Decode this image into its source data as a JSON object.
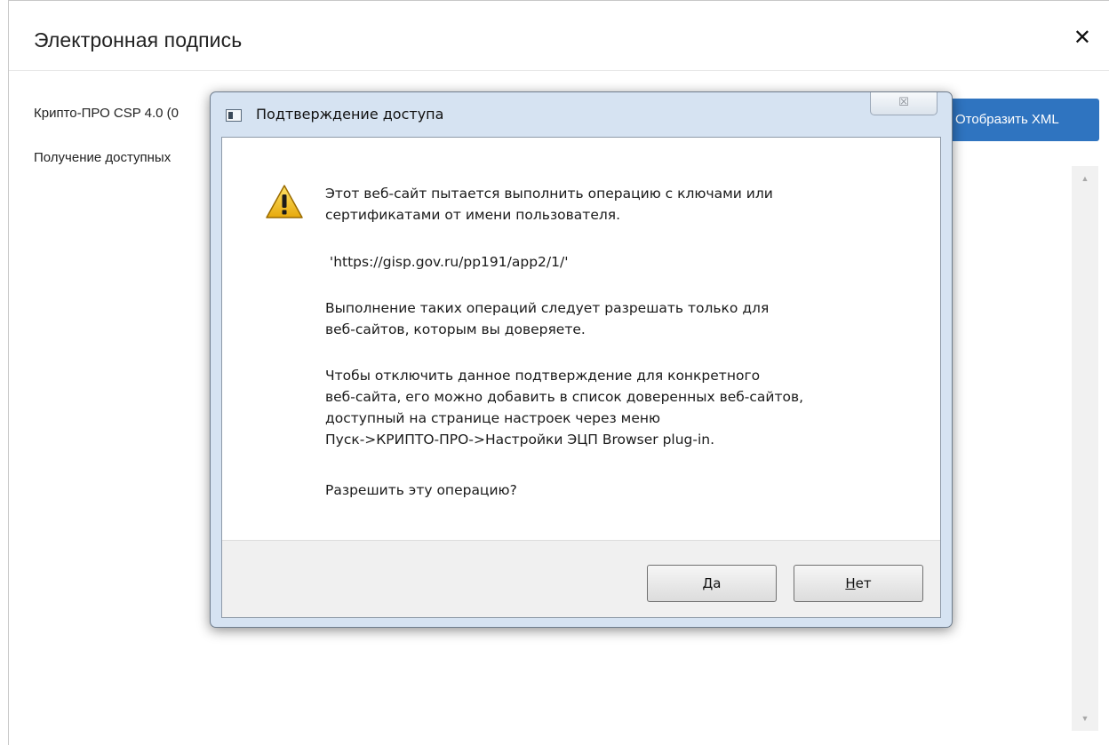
{
  "modal": {
    "title": "Электронная подпись",
    "close_glyph": "✕",
    "csp_text": "Крипто-ПРО CSP 4.0 (0",
    "status_text": "Получение доступных",
    "show_xml_button": "Отобразить XML",
    "scroll_up_glyph": "▲",
    "scroll_down_glyph": "▼"
  },
  "dialog": {
    "title": "Подтверждение доступа",
    "close_glyph": "☒",
    "icon": "warning-icon",
    "messages": {
      "line1": "Этот веб-сайт пытается выполнить операцию с ключами или\nсертификатами от имени пользователя.",
      "url": " 'https://gisp.gov.ru/pp191/app2/1/'",
      "line2": "Выполнение таких операций следует разрешать только для\nвеб-сайтов, которым вы доверяете.",
      "line3": "Чтобы отключить данное подтверждение для конкретного\nвеб-сайта, его можно добавить в список доверенных веб-сайтов,\nдоступный на странице настроек через меню\nПуск->КРИПТО-ПРО->Настройки ЭЦП Browser plug-in.",
      "question": "Разрешить эту операцию?"
    },
    "buttons": {
      "yes": {
        "mnemonic": "Д",
        "rest": "а"
      },
      "no": {
        "mnemonic": "Н",
        "rest": "ет"
      }
    }
  },
  "colors": {
    "accent_button": "#2f74c0",
    "dialog_frame": "#d6e3f2",
    "warning_yellow": "#f2c21a"
  }
}
